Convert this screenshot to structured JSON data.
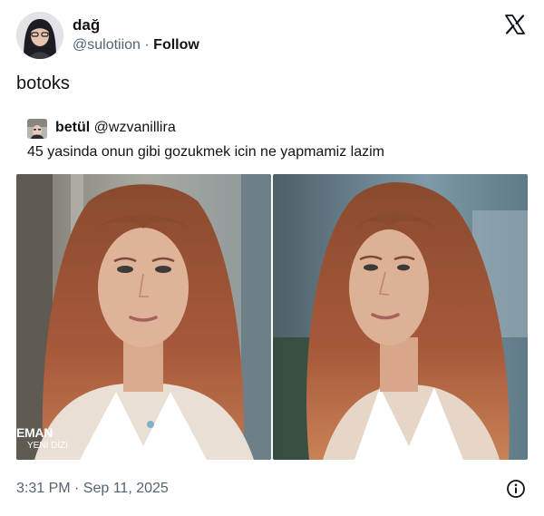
{
  "author": {
    "display_name": "dağ",
    "handle": "@sulotiion",
    "separator": " · ",
    "follow_label": "Follow"
  },
  "tweet": {
    "text": "botoks",
    "timestamp": "3:31 PM · Sep 11, 2025"
  },
  "quoted_tweet": {
    "display_name": "betül",
    "handle": "@wzvanillira",
    "text": "45 yasinda onun gibi gozukmek icin ne yapmamiz lazim"
  },
  "media": {
    "watermark_main": "EMAN",
    "watermark_sub": "YENİ DİZİ"
  },
  "icons": {
    "x_logo": "x-logo-icon",
    "info": "info-icon"
  },
  "colors": {
    "text": "#0f1419",
    "secondary_text": "#536471",
    "hair": "#a7593a"
  }
}
